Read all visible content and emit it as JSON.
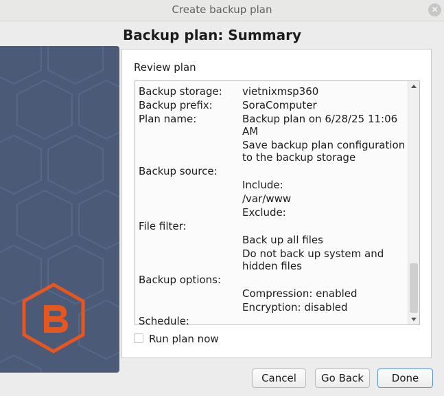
{
  "window": {
    "title": "Create backup plan"
  },
  "page": {
    "heading": "Backup plan: Summary",
    "section_label": "Review plan"
  },
  "summary": {
    "backup_storage_key": "Backup storage:",
    "backup_storage_value": "vietnixmsp360",
    "backup_prefix_key": "Backup prefix:",
    "backup_prefix_value": "SoraComputer",
    "plan_name_key": "Plan name:",
    "plan_name_value_line1": "Backup plan on 6/28/25 11:06",
    "plan_name_value_line2": "AM",
    "save_config_line1": "Save backup plan configuration",
    "save_config_line2": "to the backup storage",
    "backup_source_key": "Backup source:",
    "include_label": "Include:",
    "include_path": "/var/www",
    "exclude_label": "Exclude:",
    "file_filter_key": "File filter:",
    "file_filter_value": "Back up all files",
    "hidden_files_line1": "Do not back up system and",
    "hidden_files_line2": "hidden files",
    "backup_options_key": "Backup options:",
    "compression": "Compression: enabled",
    "encryption": "Encryption: disabled",
    "schedule_key": "Schedule:"
  },
  "options": {
    "run_plan_now_label": "Run plan now",
    "run_plan_now_checked": false
  },
  "buttons": {
    "cancel": "Cancel",
    "go_back": "Go Back",
    "done": "Done"
  },
  "icons": {
    "close": "close-icon",
    "logo": "brand-logo-icon"
  },
  "colors": {
    "side_panel": "#4a5a77",
    "logo_accent": "#e8561f",
    "done_border": "#5a8fd8"
  }
}
